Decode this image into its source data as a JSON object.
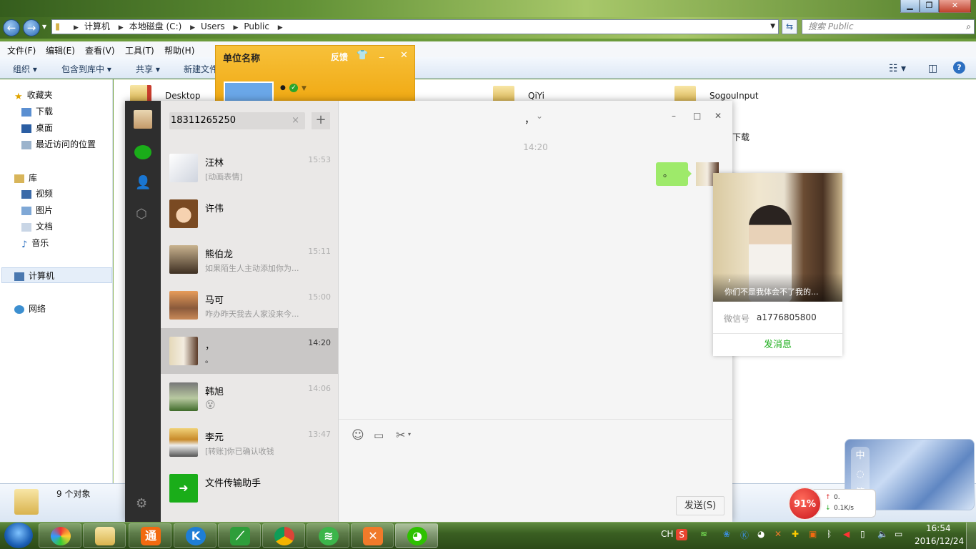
{
  "explorer": {
    "address_parts": [
      "计算机",
      "本地磁盘 (C:)",
      "Users",
      "Public"
    ],
    "search_placeholder": "搜索 Public",
    "menu": [
      "文件(F)",
      "编辑(E)",
      "查看(V)",
      "工具(T)",
      "帮助(H)"
    ],
    "toolbar": [
      "组织",
      "包含到库中",
      "共享",
      "新建文件"
    ],
    "nav": {
      "favorites": "收藏夹",
      "fav_items": [
        "下载",
        "桌面",
        "最近访问的位置"
      ],
      "libraries": "库",
      "lib_items": [
        "视频",
        "图片",
        "文档",
        "音乐"
      ],
      "computer": "计算机",
      "network": "网络"
    },
    "folders": [
      "Desktop",
      "QiYi",
      "SogouInput"
    ],
    "folder_fragment": "下载",
    "status": "9 个对象"
  },
  "unit_popup": {
    "title": "单位名称",
    "feedback": "反馈"
  },
  "wechat": {
    "search_value": "18311265250",
    "chats": [
      {
        "name": "汪林",
        "time": "15:53",
        "preview": "[动画表情]"
      },
      {
        "name": "许伟",
        "time": "",
        "preview": ""
      },
      {
        "name": "熊伯龙",
        "time": "15:11",
        "preview": "如果陌生人主动添加你为..."
      },
      {
        "name": "马可",
        "time": "15:00",
        "preview": "咋办昨天我去人家没来今..."
      },
      {
        "name": "，",
        "time": "14:20",
        "preview": "。"
      },
      {
        "name": "韩旭",
        "time": "14:06",
        "preview": "😵"
      },
      {
        "name": "李元",
        "time": "13:47",
        "preview": "[转账]你已确认收钱"
      },
      {
        "name": "文件传输助手",
        "time": "",
        "preview": ""
      }
    ],
    "chat_title": "，",
    "message_time": "14:20",
    "message_text": "。",
    "send_label": "发送(S)"
  },
  "profile": {
    "name": "，",
    "signature": "你们不是我体会不了我的...",
    "wechat_id_label": "微信号",
    "wechat_id": "a1776805800",
    "send_message": "发消息"
  },
  "widgets": {
    "net_percent": "91%",
    "net_up": "0.",
    "net_down": "0.1K/s"
  },
  "taskbar": {
    "lang": "CH",
    "time": "16:54",
    "date": "2016/12/24"
  }
}
